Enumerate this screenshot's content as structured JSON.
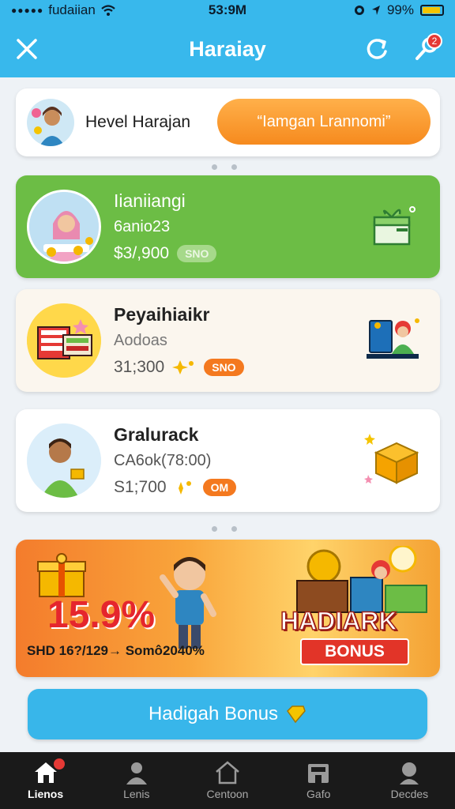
{
  "status_bar": {
    "carrier": "fudaiian",
    "time": "53:9M",
    "battery": "99%",
    "battery_level": 0.9
  },
  "header": {
    "title": "Haraiay"
  },
  "profile": {
    "name": "Hevel Harajan",
    "button_label": "“Iamgan Lrannomi”"
  },
  "offers": [
    {
      "name": "Iianiiangi",
      "sub": "6anio23",
      "price": "$3/,900",
      "tag": "SNO"
    },
    {
      "name": "Peyaihiaikr",
      "sub": "Aodoas",
      "price": "31;300",
      "tag": "SNO"
    },
    {
      "name": "Gralurack",
      "sub": "CA6ok(78:00)",
      "price": "S1;700",
      "tag": "OM"
    }
  ],
  "banner": {
    "percent": "15.9%",
    "promo_line": "SHD 16?/129→ Somô2040%",
    "headline": "HADIARK",
    "tag": "BONUS"
  },
  "cta": {
    "label": "Hadigah Bonus"
  },
  "nav": [
    {
      "label": "Lienos"
    },
    {
      "label": "Lenis"
    },
    {
      "label": "Centoon"
    },
    {
      "label": "Gafo"
    },
    {
      "label": "Decdes"
    }
  ],
  "colors": {
    "primary": "#38b8ec",
    "green_card": "#6cbd45",
    "accent_orange": "#f68a1e",
    "badge_red": "#e53935"
  }
}
